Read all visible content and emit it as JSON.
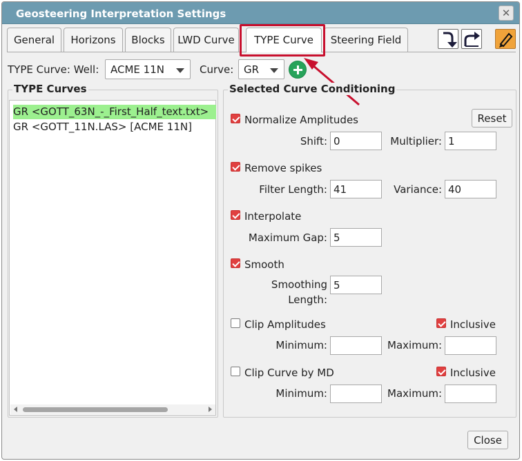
{
  "window": {
    "title": "Geosteering Interpretation Settings"
  },
  "tabs": [
    {
      "label": "General"
    },
    {
      "label": "Horizons"
    },
    {
      "label": "Blocks"
    },
    {
      "label": "LWD Curve"
    },
    {
      "label": "TYPE Curve"
    },
    {
      "label": "Steering Field"
    }
  ],
  "toolbar": {
    "import_icon": "import-down-arrow-icon",
    "export_icon": "export-share-icon",
    "edit_icon": "pencil-edit-icon"
  },
  "selector": {
    "type_curve_well_label": "TYPE Curve: Well:",
    "well_value": "ACME 11N",
    "curve_label": "Curve:",
    "curve_value": "GR"
  },
  "type_curves": {
    "legend": "TYPE Curves",
    "items": [
      {
        "label": "GR <GOTT_63N_-_First_Half_text.txt>",
        "selected": true
      },
      {
        "label": "GR <GOTT_11N.LAS> [ACME 11N]",
        "selected": false
      }
    ]
  },
  "conditioning": {
    "legend": "Selected Curve Conditioning",
    "reset_label": "Reset",
    "normalize": {
      "label": "Normalize Amplitudes",
      "checked": true,
      "shift_label": "Shift:",
      "shift_value": "0",
      "multiplier_label": "Multiplier:",
      "multiplier_value": "1"
    },
    "spikes": {
      "label": "Remove spikes",
      "checked": true,
      "filter_label": "Filter Length:",
      "filter_value": "41",
      "variance_label": "Variance:",
      "variance_value": "40"
    },
    "interpolate": {
      "label": "Interpolate",
      "checked": true,
      "gap_label": "Maximum Gap:",
      "gap_value": "5"
    },
    "smooth": {
      "label": "Smooth",
      "checked": true,
      "length_label_1": "Smoothing",
      "length_label_2": "Length:",
      "length_value": "5"
    },
    "clip_amplitudes": {
      "label": "Clip Amplitudes",
      "checked": false,
      "inclusive_label": "Inclusive",
      "inclusive_checked": true,
      "min_label": "Minimum:",
      "min_value": "",
      "max_label": "Maximum:",
      "max_value": ""
    },
    "clip_md": {
      "label": "Clip Curve by MD",
      "checked": false,
      "inclusive_label": "Inclusive",
      "inclusive_checked": true,
      "min_label": "Minimum:",
      "min_value": "",
      "max_label": "Maximum:",
      "max_value": ""
    }
  },
  "footer": {
    "close_label": "Close"
  },
  "colors": {
    "titlebar": "#6d9bb0",
    "selection": "#9cf08f",
    "check": "#e04040",
    "annotation": "#c8102e"
  }
}
